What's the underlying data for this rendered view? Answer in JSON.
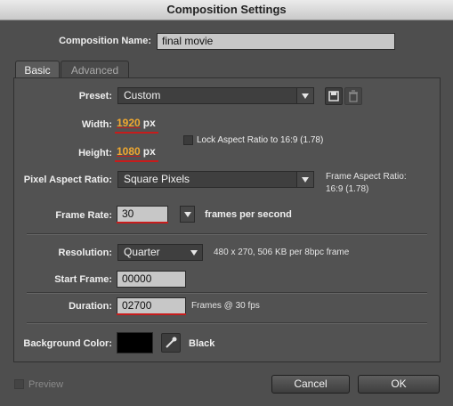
{
  "window": {
    "title": "Composition Settings"
  },
  "composition": {
    "name_label": "Composition Name:",
    "name_value": "final movie"
  },
  "tabs": [
    {
      "label": "Basic",
      "active": true
    },
    {
      "label": "Advanced",
      "active": false
    }
  ],
  "preset": {
    "label": "Preset:",
    "value": "Custom",
    "save_icon": "save-preset-icon",
    "delete_icon": "trash-icon"
  },
  "width": {
    "label": "Width:",
    "value": "1920",
    "unit": "px"
  },
  "height": {
    "label": "Height:",
    "value": "1080",
    "unit": "px"
  },
  "lock_aspect": {
    "label": "Lock Aspect Ratio to 16:9 (1.78)",
    "checked": false
  },
  "pixel_aspect": {
    "label": "Pixel Aspect Ratio:",
    "value": "Square Pixels",
    "frame_aspect_label": "Frame Aspect Ratio:",
    "frame_aspect_value": "16:9 (1.78)"
  },
  "frame_rate": {
    "label": "Frame Rate:",
    "value": "30",
    "unit": "frames per second"
  },
  "resolution": {
    "label": "Resolution:",
    "value": "Quarter",
    "info": "480 x 270, 506 KB per 8bpc frame"
  },
  "start_frame": {
    "label": "Start Frame:",
    "value": "00000"
  },
  "duration": {
    "label": "Duration:",
    "value": "02700",
    "info": "Frames @ 30 fps"
  },
  "background": {
    "label": "Background Color:",
    "color": "#000000",
    "name": "Black",
    "eyedropper_icon": "eyedropper-icon"
  },
  "footer": {
    "preview_label": "Preview",
    "preview_checked": false,
    "cancel_label": "Cancel",
    "ok_label": "OK"
  },
  "colors": {
    "window_bg": "#4e4e4e",
    "panel_bg": "#525252",
    "field_bg": "#c7c7c7",
    "value_orange": "#f0a830",
    "error_underline": "#c61c1c"
  }
}
